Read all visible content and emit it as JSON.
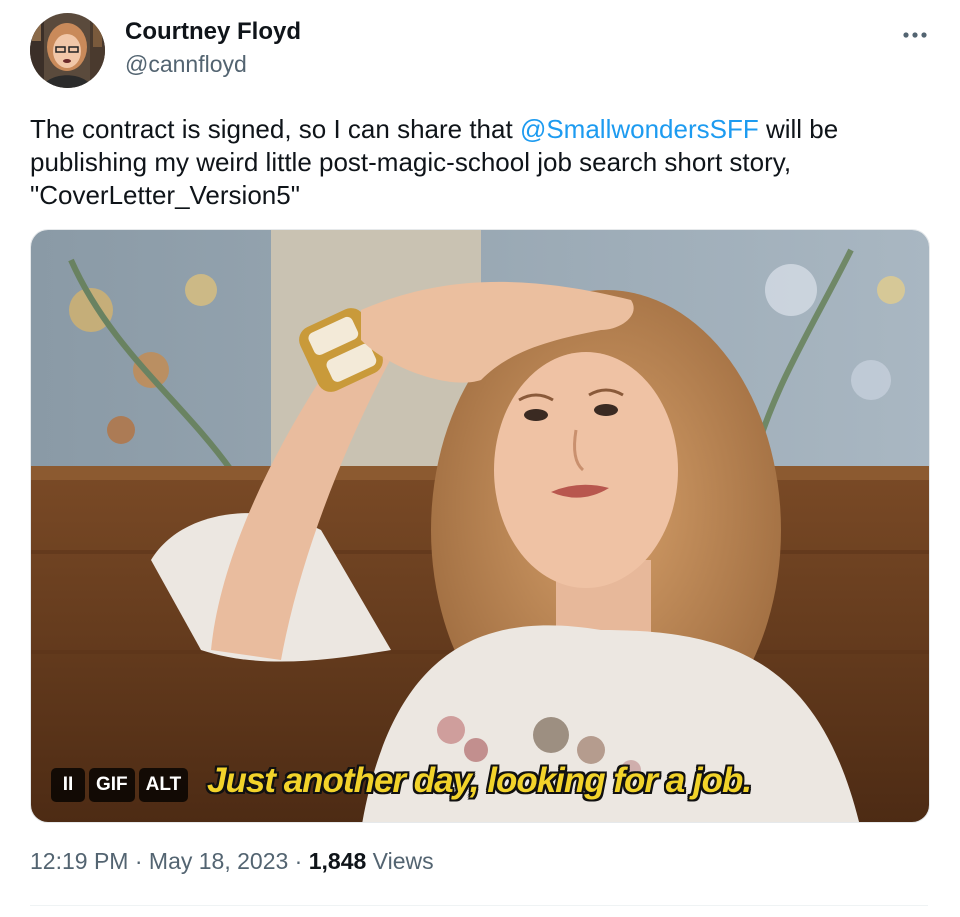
{
  "author": {
    "display_name": "Courtney Floyd",
    "handle": "@cannfloyd"
  },
  "more_icon": "more-horizontal-icon",
  "tweet": {
    "text_before": "The contract is signed, so I can share that ",
    "mention": "@SmallwondersSFF",
    "text_after": " will be publishing my weird little post-magic-school job search short story, \"CoverLetter_Version5\""
  },
  "media": {
    "type": "gif",
    "pause_icon": "II",
    "gif_badge": "GIF",
    "alt_badge": "ALT",
    "subtitle": "Just another day, looking for a job."
  },
  "meta": {
    "time": "12:19 PM",
    "separator": " · ",
    "date": "May 18, 2023",
    "views_count": "1,848",
    "views_label": " Views"
  },
  "colors": {
    "link": "#1d9bf0",
    "secondary_text": "#536471",
    "primary_text": "#0f1419",
    "subtitle": "#f2d32a"
  }
}
